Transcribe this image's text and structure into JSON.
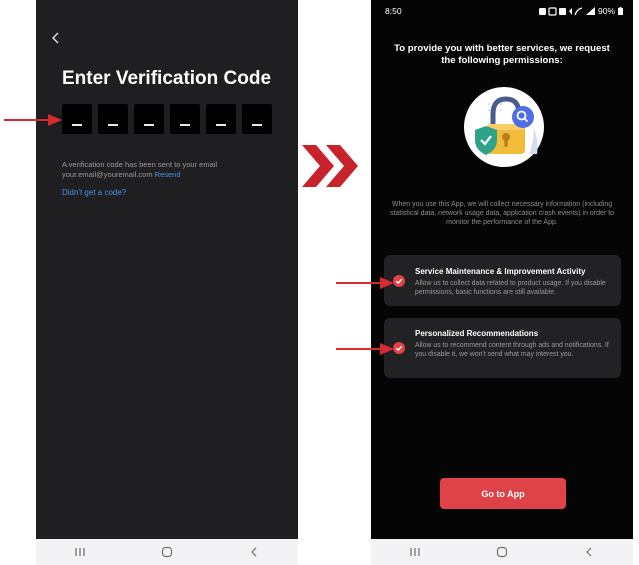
{
  "left_screen": {
    "title": "Enter Verification Code",
    "code_boxes": [
      "_",
      "_",
      "_",
      "_",
      "_",
      "_"
    ],
    "sent_message": "A verification code has been sent to your email your.email@youremail.com",
    "resend_label": "Resend",
    "no_code_link": "Didn't get a code?"
  },
  "right_screen": {
    "status_time": "8:50",
    "status_battery": "90%",
    "permissions_title": "To provide you with better services, we request the following permissions:",
    "description": "When you use this App, we will collect necessary information (including statistical data, network usage data, application crash events) in order to monitor the performance of the App.",
    "cards": [
      {
        "title": "Service Maintenance & Improvement Activity",
        "description": "Allow us to collect data related to product usage. If you disable permissions, basic functions are still available.",
        "checked": true
      },
      {
        "title": "Personalized Recommendations",
        "description": "Allow us to recommend content through ads and notifications. If you disable it, we won't send what may interest you.",
        "checked": true
      }
    ],
    "go_button_label": "Go to App"
  },
  "colors": {
    "accent_red": "#df4348",
    "link_blue": "#4a8fe7",
    "left_background": "#1f1f21",
    "right_background": "#050505",
    "card_background": "#222225"
  },
  "icons": [
    "back-arrow-icon",
    "right-chevrons-icon",
    "pointer-arrow-icon",
    "lock-shield-illustration",
    "check-circle-icon",
    "recent-apps-icon",
    "home-icon",
    "back-icon"
  ]
}
